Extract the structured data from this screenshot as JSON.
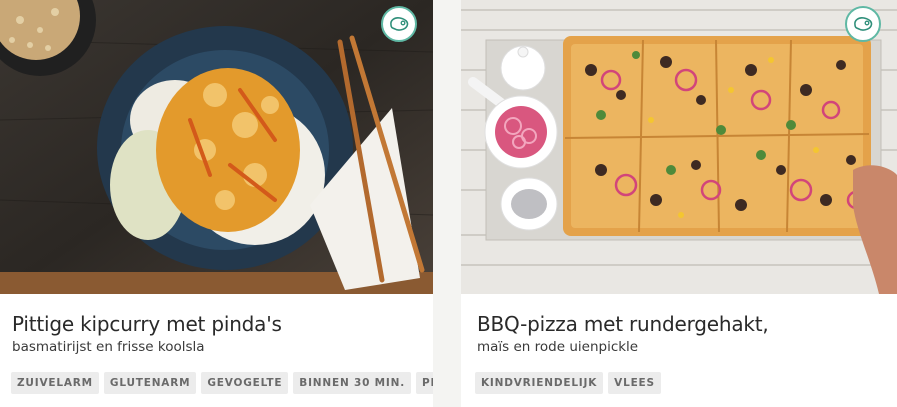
{
  "recipes": [
    {
      "title": "Pittige kipcurry met pinda's",
      "subtitle": "basmatirijst en frisse koolsla",
      "badge_icon": "meat-icon",
      "tags": [
        "ZUIVELARM",
        "GLUTENARM",
        "GEVOGELTE",
        "BINNEN 30 MIN.",
        "PITTIG"
      ]
    },
    {
      "title": "BBQ-pizza met rundergehakt,",
      "subtitle": "maïs en rode uienpickle",
      "badge_icon": "meat-icon",
      "tags": [
        "KINDVRIENDELIJK",
        "VLEES"
      ]
    }
  ],
  "colors": {
    "badge_border": "#5fb8a4",
    "tag_background": "#ececec",
    "tag_text": "#6a6a6a",
    "title_text": "#2a2a2a"
  }
}
